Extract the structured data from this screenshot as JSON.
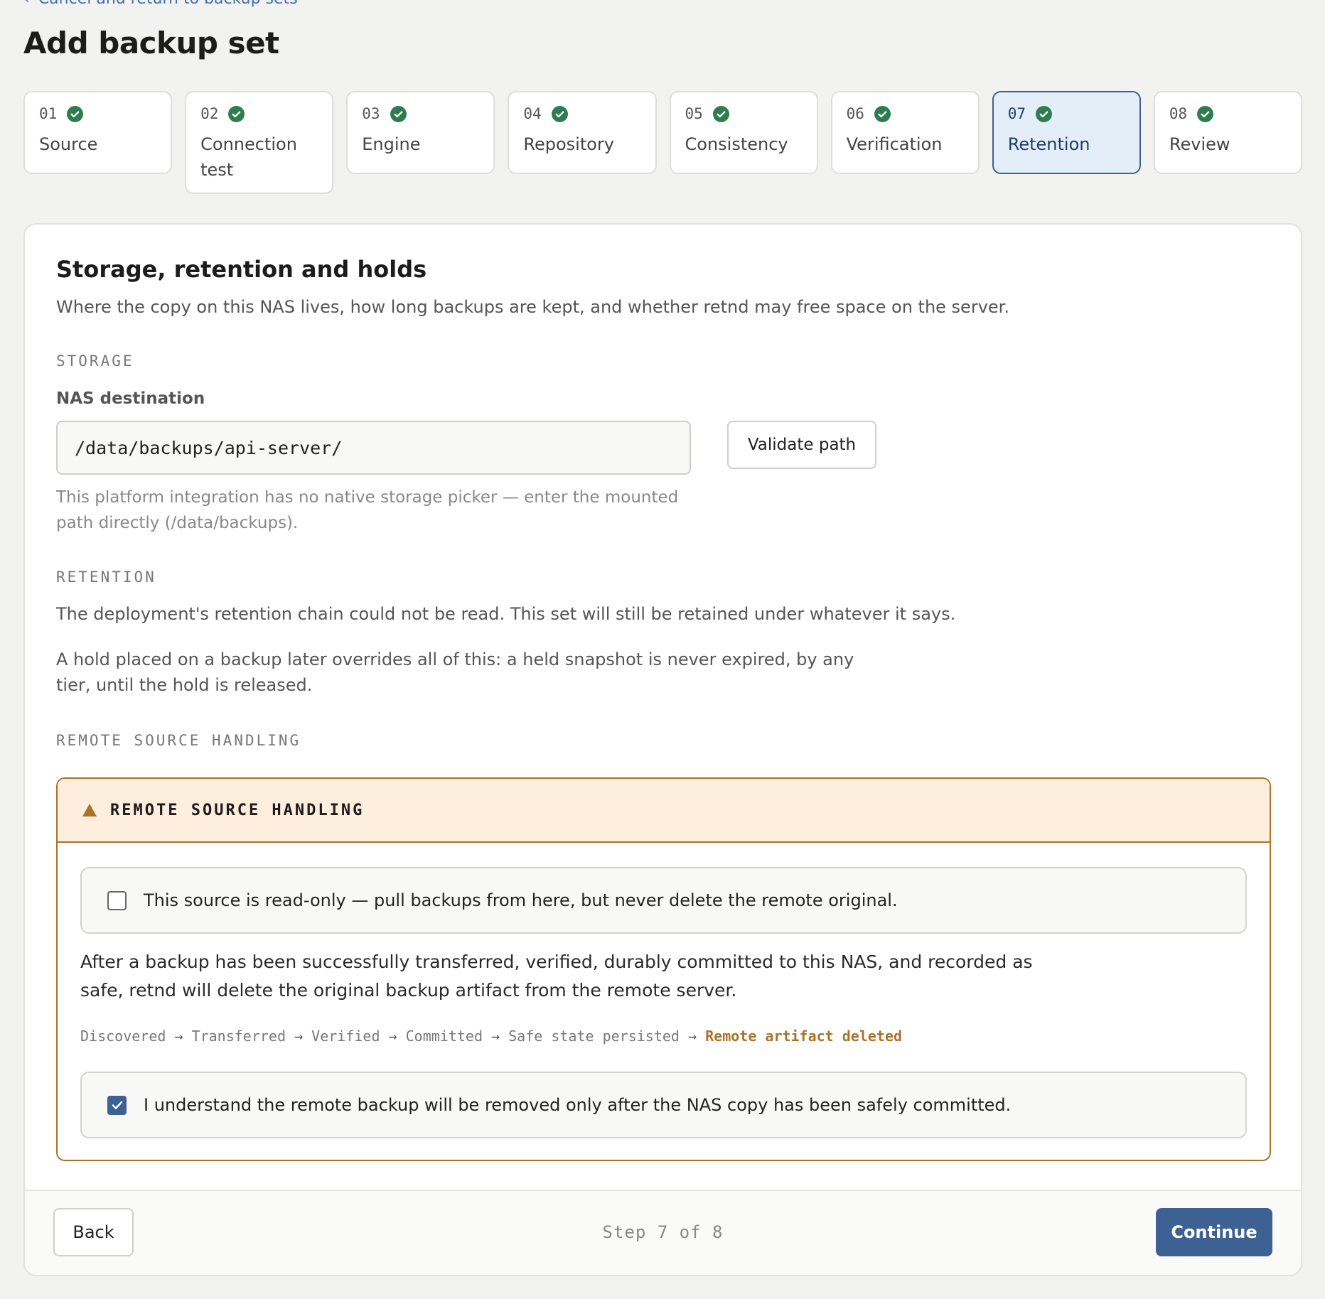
{
  "nav": {
    "back_link": "Cancel and return to backup sets"
  },
  "page": {
    "title": "Add backup set"
  },
  "stepper": {
    "steps": [
      {
        "num": "01",
        "label": "Source",
        "complete": true
      },
      {
        "num": "02",
        "label": "Connection test",
        "complete": true
      },
      {
        "num": "03",
        "label": "Engine",
        "complete": true
      },
      {
        "num": "04",
        "label": "Repository",
        "complete": true
      },
      {
        "num": "05",
        "label": "Consistency",
        "complete": true
      },
      {
        "num": "06",
        "label": "Verification",
        "complete": true
      },
      {
        "num": "07",
        "label": "Retention",
        "complete": true,
        "active": true
      },
      {
        "num": "08",
        "label": "Review",
        "complete": true
      }
    ],
    "check_color": "#2e7d4f",
    "active_color": "#3d6193"
  },
  "section": {
    "title": "Storage, retention and holds",
    "description": "Where the copy on this NAS lives, how long backups are kept, and whether retnd may free space on the server."
  },
  "storage": {
    "heading": "STORAGE",
    "field_label": "NAS destination",
    "path_value": "/data/backups/api-server/",
    "validate_label": "Validate path",
    "hint": "This platform integration has no native storage picker — enter the mounted path directly (/data/backups)."
  },
  "retention": {
    "heading": "RETENTION",
    "chain_note": "The deployment's retention chain could not be read. This set will still be retained under whatever it says.",
    "hold_note": "A hold placed on a backup later overrides all of this: a held snapshot is never expired, by any tier, until the hold is released."
  },
  "remote": {
    "heading": "REMOTE SOURCE HANDLING",
    "box_title": "REMOTE SOURCE HANDLING",
    "warning_icon": "warning-triangle-icon",
    "warning_color": "#a9742a",
    "readonly_label": "This source is read-only — pull backups from here, but never delete the remote original.",
    "readonly_checked": false,
    "explanation": "After a backup has been successfully transferred, verified, durably committed to this NAS, and recorded as safe, retnd will delete the original backup artifact from the remote server.",
    "pipeline": [
      "Discovered",
      "Transferred",
      "Verified",
      "Committed",
      "Safe state persisted"
    ],
    "pipeline_final": "Remote artifact deleted",
    "pipeline_arrow": "→",
    "ack_label": "I understand the remote backup will be removed only after the NAS copy has been safely committed.",
    "ack_checked": true
  },
  "footer": {
    "back_label": "Back",
    "step_indicator": "Step 7 of 8",
    "continue_label": "Continue"
  }
}
